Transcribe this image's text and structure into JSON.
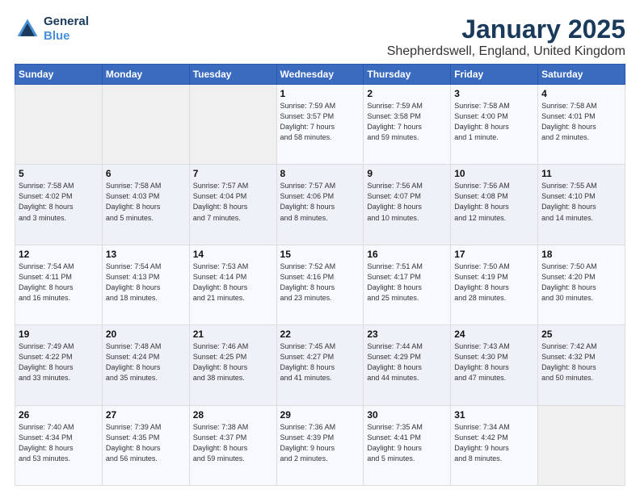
{
  "header": {
    "logo_line1": "General",
    "logo_line2": "Blue",
    "title": "January 2025",
    "subtitle": "Shepherdswell, England, United Kingdom"
  },
  "days_of_week": [
    "Sunday",
    "Monday",
    "Tuesday",
    "Wednesday",
    "Thursday",
    "Friday",
    "Saturday"
  ],
  "weeks": [
    [
      {
        "day": "",
        "info": ""
      },
      {
        "day": "",
        "info": ""
      },
      {
        "day": "",
        "info": ""
      },
      {
        "day": "1",
        "info": "Sunrise: 7:59 AM\nSunset: 3:57 PM\nDaylight: 7 hours\nand 58 minutes."
      },
      {
        "day": "2",
        "info": "Sunrise: 7:59 AM\nSunset: 3:58 PM\nDaylight: 7 hours\nand 59 minutes."
      },
      {
        "day": "3",
        "info": "Sunrise: 7:58 AM\nSunset: 4:00 PM\nDaylight: 8 hours\nand 1 minute."
      },
      {
        "day": "4",
        "info": "Sunrise: 7:58 AM\nSunset: 4:01 PM\nDaylight: 8 hours\nand 2 minutes."
      }
    ],
    [
      {
        "day": "5",
        "info": "Sunrise: 7:58 AM\nSunset: 4:02 PM\nDaylight: 8 hours\nand 3 minutes."
      },
      {
        "day": "6",
        "info": "Sunrise: 7:58 AM\nSunset: 4:03 PM\nDaylight: 8 hours\nand 5 minutes."
      },
      {
        "day": "7",
        "info": "Sunrise: 7:57 AM\nSunset: 4:04 PM\nDaylight: 8 hours\nand 7 minutes."
      },
      {
        "day": "8",
        "info": "Sunrise: 7:57 AM\nSunset: 4:06 PM\nDaylight: 8 hours\nand 8 minutes."
      },
      {
        "day": "9",
        "info": "Sunrise: 7:56 AM\nSunset: 4:07 PM\nDaylight: 8 hours\nand 10 minutes."
      },
      {
        "day": "10",
        "info": "Sunrise: 7:56 AM\nSunset: 4:08 PM\nDaylight: 8 hours\nand 12 minutes."
      },
      {
        "day": "11",
        "info": "Sunrise: 7:55 AM\nSunset: 4:10 PM\nDaylight: 8 hours\nand 14 minutes."
      }
    ],
    [
      {
        "day": "12",
        "info": "Sunrise: 7:54 AM\nSunset: 4:11 PM\nDaylight: 8 hours\nand 16 minutes."
      },
      {
        "day": "13",
        "info": "Sunrise: 7:54 AM\nSunset: 4:13 PM\nDaylight: 8 hours\nand 18 minutes."
      },
      {
        "day": "14",
        "info": "Sunrise: 7:53 AM\nSunset: 4:14 PM\nDaylight: 8 hours\nand 21 minutes."
      },
      {
        "day": "15",
        "info": "Sunrise: 7:52 AM\nSunset: 4:16 PM\nDaylight: 8 hours\nand 23 minutes."
      },
      {
        "day": "16",
        "info": "Sunrise: 7:51 AM\nSunset: 4:17 PM\nDaylight: 8 hours\nand 25 minutes."
      },
      {
        "day": "17",
        "info": "Sunrise: 7:50 AM\nSunset: 4:19 PM\nDaylight: 8 hours\nand 28 minutes."
      },
      {
        "day": "18",
        "info": "Sunrise: 7:50 AM\nSunset: 4:20 PM\nDaylight: 8 hours\nand 30 minutes."
      }
    ],
    [
      {
        "day": "19",
        "info": "Sunrise: 7:49 AM\nSunset: 4:22 PM\nDaylight: 8 hours\nand 33 minutes."
      },
      {
        "day": "20",
        "info": "Sunrise: 7:48 AM\nSunset: 4:24 PM\nDaylight: 8 hours\nand 35 minutes."
      },
      {
        "day": "21",
        "info": "Sunrise: 7:46 AM\nSunset: 4:25 PM\nDaylight: 8 hours\nand 38 minutes."
      },
      {
        "day": "22",
        "info": "Sunrise: 7:45 AM\nSunset: 4:27 PM\nDaylight: 8 hours\nand 41 minutes."
      },
      {
        "day": "23",
        "info": "Sunrise: 7:44 AM\nSunset: 4:29 PM\nDaylight: 8 hours\nand 44 minutes."
      },
      {
        "day": "24",
        "info": "Sunrise: 7:43 AM\nSunset: 4:30 PM\nDaylight: 8 hours\nand 47 minutes."
      },
      {
        "day": "25",
        "info": "Sunrise: 7:42 AM\nSunset: 4:32 PM\nDaylight: 8 hours\nand 50 minutes."
      }
    ],
    [
      {
        "day": "26",
        "info": "Sunrise: 7:40 AM\nSunset: 4:34 PM\nDaylight: 8 hours\nand 53 minutes."
      },
      {
        "day": "27",
        "info": "Sunrise: 7:39 AM\nSunset: 4:35 PM\nDaylight: 8 hours\nand 56 minutes."
      },
      {
        "day": "28",
        "info": "Sunrise: 7:38 AM\nSunset: 4:37 PM\nDaylight: 8 hours\nand 59 minutes."
      },
      {
        "day": "29",
        "info": "Sunrise: 7:36 AM\nSunset: 4:39 PM\nDaylight: 9 hours\nand 2 minutes."
      },
      {
        "day": "30",
        "info": "Sunrise: 7:35 AM\nSunset: 4:41 PM\nDaylight: 9 hours\nand 5 minutes."
      },
      {
        "day": "31",
        "info": "Sunrise: 7:34 AM\nSunset: 4:42 PM\nDaylight: 9 hours\nand 8 minutes."
      },
      {
        "day": "",
        "info": ""
      }
    ]
  ]
}
